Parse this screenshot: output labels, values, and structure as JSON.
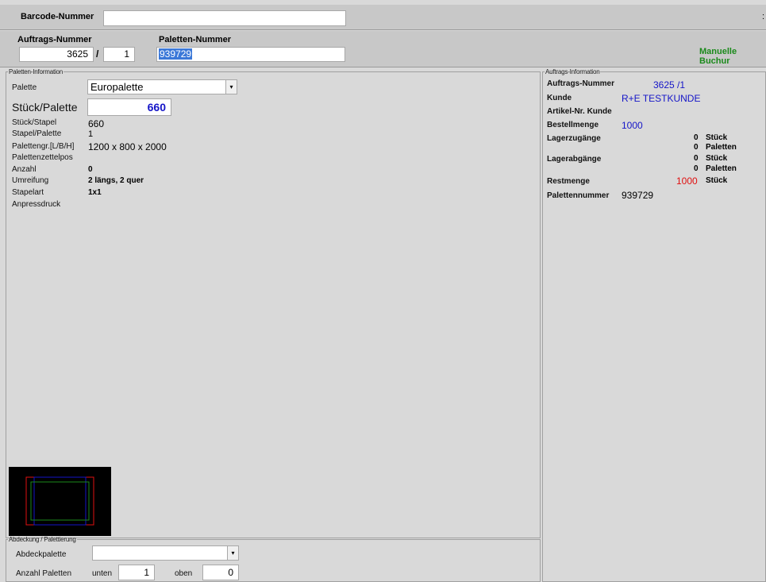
{
  "top": {
    "barcode_label": "Barcode-Nummer",
    "barcode_value": "",
    "right_edge_mark": ":"
  },
  "order_bar": {
    "auftrag_label": "Auftrags-Nummer",
    "auftrag_value": "3625",
    "slash": "/",
    "position_value": "1",
    "paletten_label": "Paletten-Nummer",
    "paletten_value": "939729",
    "manual_booking": "Manuelle Buchur"
  },
  "paletten_info": {
    "legend": "Paletten-Information",
    "palette_label": "Palette",
    "palette_selected": "Europalette",
    "stueck_palette_label": "Stück/Palette",
    "stueck_palette_value": "660",
    "rows": [
      {
        "label": "Stück/Stapel",
        "value": "660"
      },
      {
        "label": "Stapel/Palette",
        "value": "1"
      },
      {
        "label": "Palettengr.[L/B/H]",
        "value": "1200 x 800 x 2000"
      },
      {
        "label": "Palettenzettelpos",
        "value": ""
      },
      {
        "label": "Anzahl",
        "value": "0"
      },
      {
        "label": "Umreifung",
        "value": "2 längs, 2 quer"
      },
      {
        "label": "Stapelart",
        "value": "1x1"
      },
      {
        "label": "Anpressdruck",
        "value": ""
      }
    ]
  },
  "abdeckung": {
    "legend": "Abdeckung / Palettierung",
    "abdeckpalette_label": "Abdeckpalette",
    "abdeckpalette_value": "",
    "anzahl_label": "Anzahl Paletten",
    "unten_label": "unten",
    "unten_value": "1",
    "oben_label": "oben",
    "oben_value": "0"
  },
  "auftrags_info": {
    "legend": "Auftrags-Information",
    "auftrag_label": "Auftrags-Nummer",
    "auftrag_value": "3625 /1",
    "kunde_label": "Kunde",
    "kunde_value": "R+E TESTKUNDE",
    "artikel_label": "Artikel-Nr. Kunde",
    "bestell_label": "Bestellmenge",
    "bestell_value": "1000",
    "lagerzu_label": "Lagerzugänge",
    "lagerzu_stueck_value": "0",
    "lagerzu_stueck_unit": "Stück",
    "lagerzu_pal_value": "0",
    "lagerzu_pal_unit": "Paletten",
    "lagerab_label": "Lagerabgänge",
    "lagerab_stueck_value": "0",
    "lagerab_stueck_unit": "Stück",
    "lagerab_pal_value": "0",
    "lagerab_pal_unit": "Paletten",
    "rest_label": "Restmenge",
    "rest_value": "1000",
    "rest_unit": "Stück",
    "palettennummer_label": "Palettennummer",
    "palettennummer_value": "939729"
  },
  "colors": {
    "blue": "#1515c8",
    "red": "#e01010",
    "green": "#1b8a1b",
    "preview_bg": "#000000"
  }
}
